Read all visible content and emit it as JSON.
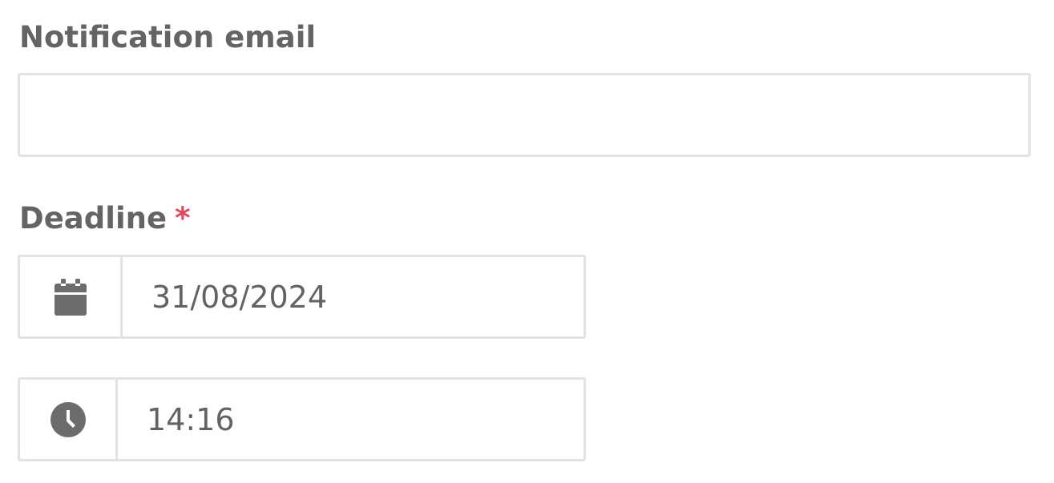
{
  "form": {
    "notification_email": {
      "label": "Notification email",
      "value": "",
      "placeholder": ""
    },
    "deadline": {
      "label": "Deadline",
      "required_marker": "*",
      "date_value": "31/08/2024",
      "time_value": "14:16",
      "date_icon": "calendar-icon",
      "time_icon": "clock-icon"
    }
  },
  "colors": {
    "label_text": "#636466",
    "required": "#e0475b",
    "border": "#e3e3e3",
    "icon": "#6b6c6e"
  }
}
